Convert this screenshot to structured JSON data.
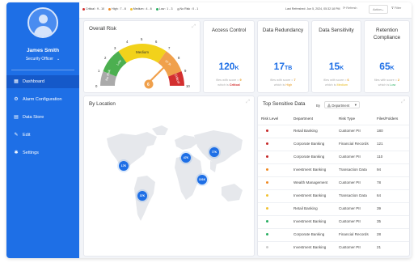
{
  "sidebar": {
    "user_name": "James Smith",
    "user_role": "Security Officer",
    "items": [
      {
        "label": "Dashboard",
        "icon": "dashboard-icon",
        "active": true
      },
      {
        "label": "Alarm Configuration",
        "icon": "alarm-icon",
        "active": false
      },
      {
        "label": "Data Store",
        "icon": "database-icon",
        "active": false
      },
      {
        "label": "Edit",
        "icon": "edit-icon",
        "active": false
      },
      {
        "label": "Settings",
        "icon": "gear-icon",
        "active": false
      }
    ]
  },
  "topbar": {
    "legend": [
      {
        "label": "Critical : 9 - 10",
        "color": "#d32f2f"
      },
      {
        "label": "High : 7 - 8",
        "color": "#f08a24"
      },
      {
        "label": "Medium : 4 - 6",
        "color": "#f2c230"
      },
      {
        "label": "Low : 1 - 3",
        "color": "#27ae60"
      },
      {
        "label": "No Risk : 0 - 1",
        "color": "#bbbbbb"
      }
    ],
    "refreshed": "Last Refreshed: Jun 5, 2024, 05:32:18 PM",
    "refresh_label": "Refresh",
    "action_label": "Action",
    "filter_label": "Filter"
  },
  "overall_risk": {
    "title": "Overall Risk",
    "gauge_value": "6",
    "gauge_ticks": [
      "0",
      "1",
      "2",
      "3",
      "4",
      "5",
      "6",
      "7",
      "8",
      "9",
      "10"
    ],
    "zones": [
      "No Risk",
      "Low",
      "Medium",
      "High",
      "Critical"
    ]
  },
  "metrics": [
    {
      "title": "Access Control",
      "value": "120",
      "unit": "K",
      "note_prefix": "files with score = ",
      "score": "9",
      "note_mid": "which is ",
      "level": "Critical",
      "level_class": "crit"
    },
    {
      "title": "Data Redundancy",
      "value": "17",
      "unit": "TB",
      "note_prefix": "files with score = ",
      "score": "7",
      "note_mid": "which is ",
      "level": "High",
      "level_class": "high"
    },
    {
      "title": "Data Sensitivity",
      "value": "15",
      "unit": "K",
      "note_prefix": "files with score = ",
      "score": "6",
      "note_mid": "which is ",
      "level": "Medium",
      "level_class": "med"
    },
    {
      "title": "Retention Compliance",
      "value": "65",
      "unit": "K",
      "note_prefix": "files with score = ",
      "score": "2",
      "note_mid": "which is ",
      "level": "Low",
      "level_class": "low"
    }
  ],
  "by_location": {
    "title": "By Location",
    "bubbles": [
      "17K",
      "47K",
      "77K",
      "101K",
      "37K"
    ]
  },
  "top_sensitive": {
    "title": "Top Sensitive Data",
    "by_label": "By",
    "group_by": "Department",
    "headers": [
      "Risk Level",
      "Department",
      "Risk Type",
      "Files/Folders"
    ],
    "rows": [
      {
        "color": "#c62828",
        "department": "Retail Banking",
        "risk_type": "Customer PII",
        "files": "180"
      },
      {
        "color": "#c62828",
        "department": "Corporate Banking",
        "risk_type": "Financial Records",
        "files": "121"
      },
      {
        "color": "#c62828",
        "department": "Corporate Banking",
        "risk_type": "Customer PII",
        "files": "110"
      },
      {
        "color": "#f08a24",
        "department": "Investment Banking",
        "risk_type": "Transaction Data",
        "files": "94"
      },
      {
        "color": "#f08a24",
        "department": "Wealth Management",
        "risk_type": "Customer PII",
        "files": "78"
      },
      {
        "color": "#f2c230",
        "department": "Investment Banking",
        "risk_type": "Transaction Data",
        "files": "64"
      },
      {
        "color": "#f2c230",
        "department": "Retail Banking",
        "risk_type": "Customer PII",
        "files": "39"
      },
      {
        "color": "#27ae60",
        "department": "Investment Banking",
        "risk_type": "Customer PII",
        "files": "35"
      },
      {
        "color": "#27ae60",
        "department": "Corporate Banking",
        "risk_type": "Financial Records",
        "files": "28"
      },
      {
        "color": "#cccccc",
        "department": "Investment Banking",
        "risk_type": "Customer PII",
        "files": "21"
      }
    ]
  }
}
